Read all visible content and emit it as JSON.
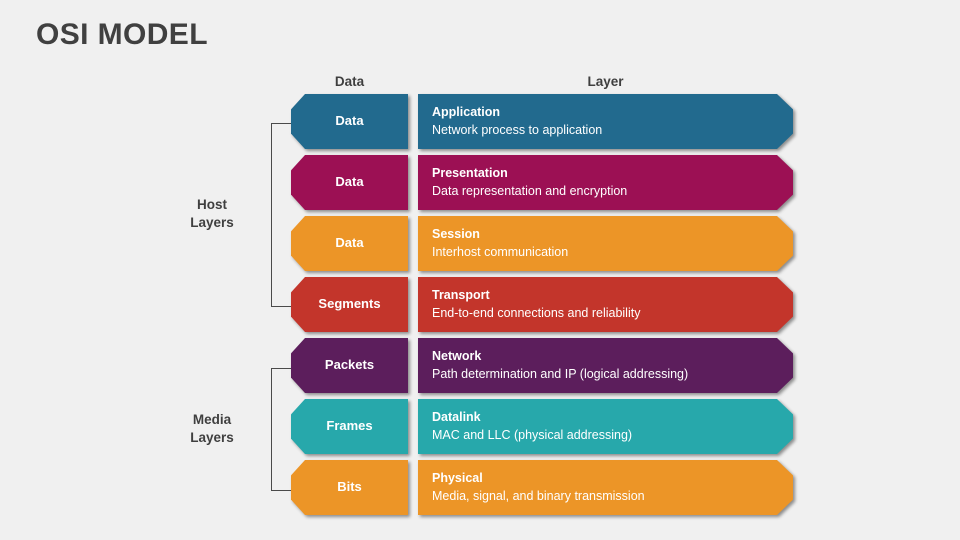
{
  "page": {
    "title": "OSI MODEL",
    "background_color": "#f0f0f0",
    "title_color": "#404040"
  },
  "headers": {
    "data": "Data",
    "layer": "Layer"
  },
  "groups": [
    {
      "id": "host",
      "label_line1": "Host",
      "label_line2": "Layers",
      "spans_rows": [
        1,
        4
      ]
    },
    {
      "id": "media",
      "label_line1": "Media",
      "label_line2": "Layers",
      "spans_rows": [
        5,
        7
      ]
    }
  ],
  "rows": [
    {
      "data_unit": "Data",
      "layer_name": "Application",
      "layer_desc": "Network process to application",
      "color": "#226a8e"
    },
    {
      "data_unit": "Data",
      "layer_name": "Presentation",
      "layer_desc": "Data representation and encryption",
      "color": "#9c1054"
    },
    {
      "data_unit": "Data",
      "layer_name": "Session",
      "layer_desc": "Interhost communication",
      "color": "#ec9527"
    },
    {
      "data_unit": "Segments",
      "layer_name": "Transport",
      "layer_desc": "End-to-end connections and reliability",
      "color": "#c3352b"
    },
    {
      "data_unit": "Packets",
      "layer_name": "Network",
      "layer_desc": "Path determination and IP (logical addressing)",
      "color": "#5c1e5c"
    },
    {
      "data_unit": "Frames",
      "layer_name": "Datalink",
      "layer_desc": "MAC and LLC (physical addressing)",
      "color": "#27a8ab"
    },
    {
      "data_unit": "Bits",
      "layer_name": "Physical",
      "layer_desc": "Media, signal, and binary transmission",
      "color": "#ec9527"
    }
  ]
}
